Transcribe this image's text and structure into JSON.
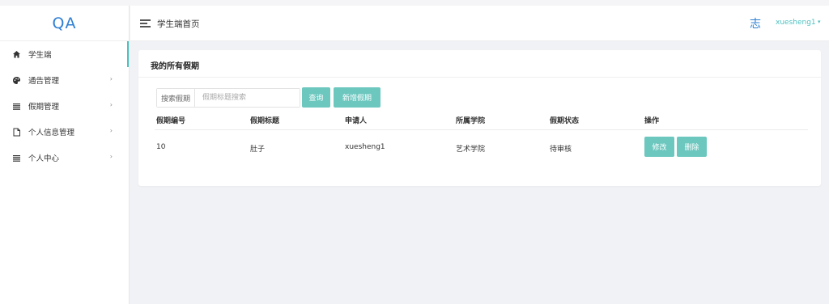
{
  "app": {
    "logo": "QA"
  },
  "sidebar": {
    "items": [
      {
        "label": "学生端",
        "icon": "home-icon"
      },
      {
        "label": "通告管理",
        "icon": "palette-icon",
        "arrow": "›"
      },
      {
        "label": "假期管理",
        "icon": "list-icon",
        "arrow": "›"
      },
      {
        "label": "个人信息管理",
        "icon": "file-icon",
        "arrow": "›"
      },
      {
        "label": "个人中心",
        "icon": "list-icon",
        "arrow": "›"
      }
    ]
  },
  "header": {
    "title": "学生端首页",
    "avatar_text": "志",
    "username": "xuesheng1",
    "caret": "▾"
  },
  "card": {
    "title": "我的所有假期",
    "search": {
      "label": "搜索假期",
      "placeholder": "假期标题搜索",
      "value": ""
    },
    "query_button": "查询",
    "add_button": "新增假期",
    "table": {
      "headers": [
        "假期编号",
        "假期标题",
        "申请人",
        "所属学院",
        "假期状态",
        "操作"
      ],
      "rows": [
        {
          "id": "10",
          "title": "肚子",
          "applicant": "xuesheng1",
          "college": "艺术学院",
          "status": "待审核",
          "edit": "修改",
          "delete": "删除"
        }
      ]
    }
  },
  "colors": {
    "accent": "#6cc7bf",
    "brand": "#2f7fd3",
    "username": "#4ec1c1"
  }
}
